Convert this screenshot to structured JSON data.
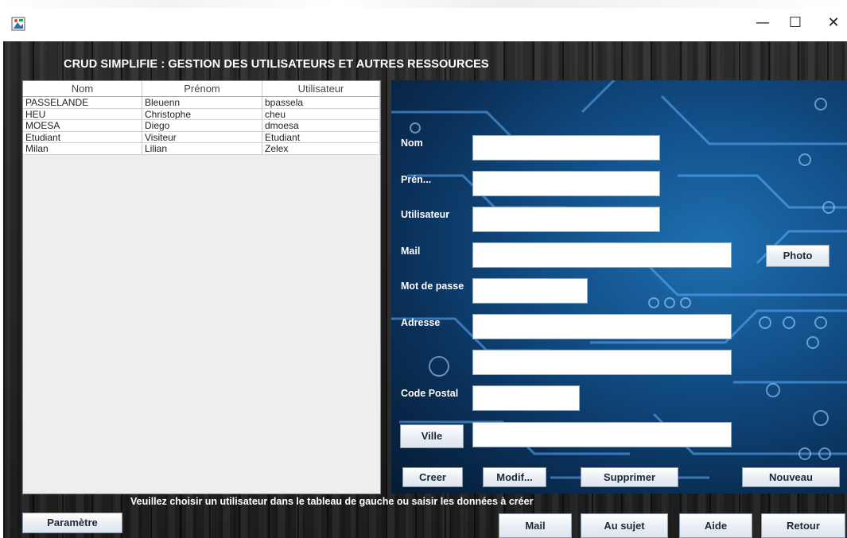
{
  "window": {
    "controls": {
      "minimize": "—",
      "maximize": "☐",
      "close": "✕"
    }
  },
  "app": {
    "title": "CRUD SIMPLIFIE : GESTION DES UTILISATEURS ET AUTRES RESSOURCES",
    "status": "Veuillez choisir un utilisateur dans le tableau de gauche ou saisir les données à créer"
  },
  "table": {
    "headers": [
      "Nom",
      "Prénom",
      "Utilisateur"
    ],
    "rows": [
      [
        "PASSELANDE",
        "Bleuenn",
        "bpassela"
      ],
      [
        "HEU",
        "Christophe",
        "cheu"
      ],
      [
        "MOESA",
        "Diego",
        "dmoesa"
      ],
      [
        "Etudiant",
        "Visiteur",
        "Etudiant"
      ],
      [
        "Milan",
        "Lilian",
        "Zelex"
      ]
    ]
  },
  "form": {
    "labels": {
      "nom": "Nom",
      "prenom": "Prén...",
      "utilisateur": "Utilisateur",
      "mail": "Mail",
      "mot_de_passe": "Mot de passe",
      "adresse": "Adresse",
      "code_postal": "Code Postal"
    },
    "values": {
      "nom": "",
      "prenom": "",
      "utilisateur": "",
      "mail": "",
      "mot_de_passe": "",
      "adresse1": "",
      "adresse2": "",
      "code_postal": "",
      "ville": ""
    },
    "buttons": {
      "photo": "Photo",
      "ville": "Ville",
      "creer": "Creer",
      "modif": "Modif...",
      "supprimer": "Supprimer",
      "nouveau": "Nouveau"
    }
  },
  "bottom": {
    "parametre": "Paramètre",
    "mail": "Mail",
    "au_sujet": "Au sujet",
    "aide": "Aide",
    "retour": "Retour"
  },
  "colors": {
    "background_wood": "#272727",
    "circuit_blue": "#12508a",
    "circuit_trace": "#5fb0ff",
    "button_text": "#1b2a3a"
  },
  "icons": {
    "app": "java-app-icon",
    "minimize": "minimize-icon",
    "maximize": "maximize-icon",
    "close": "close-icon"
  }
}
